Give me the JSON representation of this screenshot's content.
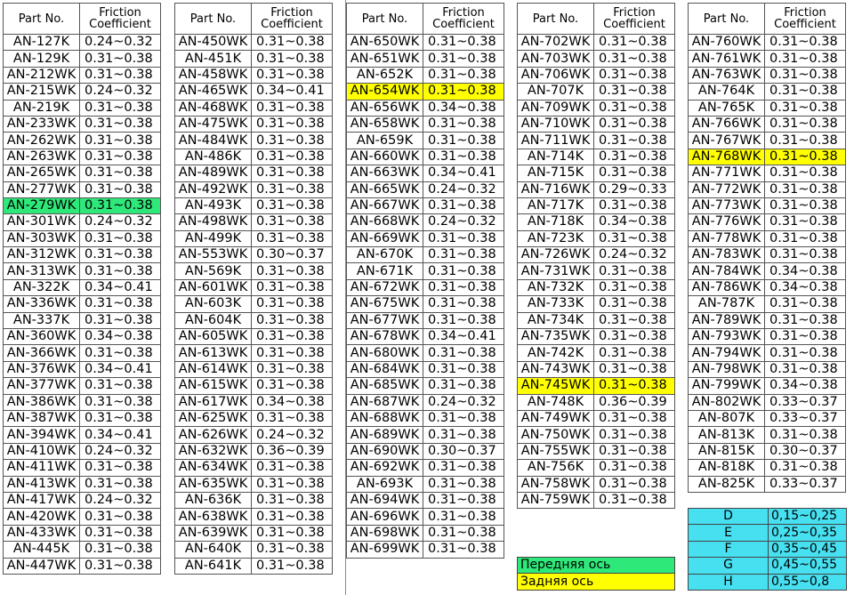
{
  "headers": {
    "part": "Part No.",
    "friction_line1": "Friction",
    "friction_line2": "Coefficient"
  },
  "highlight_colors": {
    "front_axle": "#2ee87a",
    "rear_axle": "#ffff00",
    "grade_table": "#47e0f0"
  },
  "columns": [
    {
      "rows": [
        {
          "part": "AN-127K",
          "coef": "0.24~0.32"
        },
        {
          "part": "AN-129K",
          "coef": "0.31~0.38"
        },
        {
          "part": "AN-212WK",
          "coef": "0.31~0.38"
        },
        {
          "part": "AN-215WK",
          "coef": "0.24~0.32"
        },
        {
          "part": "AN-219K",
          "coef": "0.31~0.38"
        },
        {
          "part": "AN-233WK",
          "coef": "0.31~0.38"
        },
        {
          "part": "AN-262WK",
          "coef": "0.31~0.38"
        },
        {
          "part": "AN-263WK",
          "coef": "0.31~0.38"
        },
        {
          "part": "AN-265WK",
          "coef": "0.31~0.38"
        },
        {
          "part": "AN-277WK",
          "coef": "0.31~0.38"
        },
        {
          "part": "AN-279WK",
          "coef": "0.31~0.38",
          "hl": "green"
        },
        {
          "part": "AN-301WK",
          "coef": "0.24~0.32"
        },
        {
          "part": "AN-303WK",
          "coef": "0.31~0.38"
        },
        {
          "part": "AN-312WK",
          "coef": "0.31~0.38"
        },
        {
          "part": "AN-313WK",
          "coef": "0.31~0.38"
        },
        {
          "part": "AN-322K",
          "coef": "0.34~0.41"
        },
        {
          "part": "AN-336WK",
          "coef": "0.31~0.38"
        },
        {
          "part": "AN-337K",
          "coef": "0.31~0.38"
        },
        {
          "part": "AN-360WK",
          "coef": "0.34~0.38"
        },
        {
          "part": "AN-366WK",
          "coef": "0.31~0.38"
        },
        {
          "part": "AN-376WK",
          "coef": "0.34~0.41"
        },
        {
          "part": "AN-377WK",
          "coef": "0.31~0.38"
        },
        {
          "part": "AN-386WK",
          "coef": "0.31~0.38"
        },
        {
          "part": "AN-387WK",
          "coef": "0.31~0.38"
        },
        {
          "part": "AN-394WK",
          "coef": "0.34~0.41"
        },
        {
          "part": "AN-410WK",
          "coef": "0.24~0.32"
        },
        {
          "part": "AN-411WK",
          "coef": "0.31~0.38"
        },
        {
          "part": "AN-413WK",
          "coef": "0.31~0.38"
        },
        {
          "part": "AN-417WK",
          "coef": "0.24~0.32"
        },
        {
          "part": "AN-420WK",
          "coef": "0.31~0.38"
        },
        {
          "part": "AN-433WK",
          "coef": "0.31~0.38"
        },
        {
          "part": "AN-445K",
          "coef": "0.31~0.38"
        },
        {
          "part": "AN-447WK",
          "coef": "0.31~0.38"
        }
      ]
    },
    {
      "rows": [
        {
          "part": "AN-450WK",
          "coef": "0.31~0.38"
        },
        {
          "part": "AN-451K",
          "coef": "0.31~0.38"
        },
        {
          "part": "AN-458WK",
          "coef": "0.31~0.38"
        },
        {
          "part": "AN-465WK",
          "coef": "0.34~0.41"
        },
        {
          "part": "AN-468WK",
          "coef": "0.31~0.38"
        },
        {
          "part": "AN-475WK",
          "coef": "0.31~0.38"
        },
        {
          "part": "AN-484WK",
          "coef": "0.31~0.38"
        },
        {
          "part": "AN-486K",
          "coef": "0.31~0.38"
        },
        {
          "part": "AN-489WK",
          "coef": "0.31~0.38"
        },
        {
          "part": "AN-492WK",
          "coef": "0.31~0.38"
        },
        {
          "part": "AN-493K",
          "coef": "0.31~0.38"
        },
        {
          "part": "AN-498WK",
          "coef": "0.31~0.38"
        },
        {
          "part": "AN-499K",
          "coef": "0.31~0.38"
        },
        {
          "part": "AN-553WK",
          "coef": "0.30~0.37"
        },
        {
          "part": "AN-569K",
          "coef": "0.31~0.38"
        },
        {
          "part": "AN-601WK",
          "coef": "0.31~0.38"
        },
        {
          "part": "AN-603K",
          "coef": "0.31~0.38"
        },
        {
          "part": "AN-604K",
          "coef": "0.31~0.38"
        },
        {
          "part": "AN-605WK",
          "coef": "0.31~0.38"
        },
        {
          "part": "AN-613WK",
          "coef": "0.31~0.38"
        },
        {
          "part": "AN-614WK",
          "coef": "0.31~0.38"
        },
        {
          "part": "AN-615WK",
          "coef": "0.31~0.38"
        },
        {
          "part": "AN-617WK",
          "coef": "0.34~0.38"
        },
        {
          "part": "AN-625WK",
          "coef": "0.31~0.38"
        },
        {
          "part": "AN-626WK",
          "coef": "0.24~0.32"
        },
        {
          "part": "AN-632WK",
          "coef": "0.36~0.39"
        },
        {
          "part": "AN-634WK",
          "coef": "0.31~0.38"
        },
        {
          "part": "AN-635WK",
          "coef": "0.31~0.38"
        },
        {
          "part": "AN-636K",
          "coef": "0.31~0.38"
        },
        {
          "part": "AN-638WK",
          "coef": "0.31~0.38"
        },
        {
          "part": "AN-639WK",
          "coef": "0.31~0.38"
        },
        {
          "part": "AN-640K",
          "coef": "0.31~0.38"
        },
        {
          "part": "AN-641K",
          "coef": "0.31~0.38"
        }
      ]
    },
    {
      "rows": [
        {
          "part": "AN-650WK",
          "coef": "0.31~0.38"
        },
        {
          "part": "AN-651WK",
          "coef": "0.31~0.38"
        },
        {
          "part": "AN-652K",
          "coef": "0.31~0.38"
        },
        {
          "part": "AN-654WK",
          "coef": "0.31~0.38",
          "hl": "yellow"
        },
        {
          "part": "AN-656WK",
          "coef": "0.34~0.38"
        },
        {
          "part": "AN-658WK",
          "coef": "0.31~0.38"
        },
        {
          "part": "AN-659K",
          "coef": "0.31~0.38"
        },
        {
          "part": "AN-660WK",
          "coef": "0.31~0.38"
        },
        {
          "part": "AN-663WK",
          "coef": "0.34~0.41"
        },
        {
          "part": "AN-665WK",
          "coef": "0.24~0.32"
        },
        {
          "part": "AN-667WK",
          "coef": "0.31~0.38"
        },
        {
          "part": "AN-668WK",
          "coef": "0.24~0.32"
        },
        {
          "part": "AN-669WK",
          "coef": "0.31~0.38"
        },
        {
          "part": "AN-670K",
          "coef": "0.31~0.38"
        },
        {
          "part": "AN-671K",
          "coef": "0.31~0.38"
        },
        {
          "part": "AN-672WK",
          "coef": "0.31~0.38"
        },
        {
          "part": "AN-675WK",
          "coef": "0.31~0.38"
        },
        {
          "part": "AN-677WK",
          "coef": "0.31~0.38"
        },
        {
          "part": "AN-678WK",
          "coef": "0.34~0.41"
        },
        {
          "part": "AN-680WK",
          "coef": "0.31~0.38"
        },
        {
          "part": "AN-684WK",
          "coef": "0.31~0.38"
        },
        {
          "part": "AN-685WK",
          "coef": "0.31~0.38"
        },
        {
          "part": "AN-687WK",
          "coef": "0.24~0.32"
        },
        {
          "part": "AN-688WK",
          "coef": "0.31~0.38"
        },
        {
          "part": "AN-689WK",
          "coef": "0.31~0.38"
        },
        {
          "part": "AN-690WK",
          "coef": "0.30~0.37"
        },
        {
          "part": "AN-692WK",
          "coef": "0.31~0.38"
        },
        {
          "part": "AN-693K",
          "coef": "0.31~0.38"
        },
        {
          "part": "AN-694WK",
          "coef": "0.31~0.38"
        },
        {
          "part": "AN-696WK",
          "coef": "0.31~0.38"
        },
        {
          "part": "AN-698WK",
          "coef": "0.31~0.38"
        },
        {
          "part": "AN-699WK",
          "coef": "0.31~0.38"
        }
      ]
    },
    {
      "rows": [
        {
          "part": "AN-702WK",
          "coef": "0.31~0.38"
        },
        {
          "part": "AN-703WK",
          "coef": "0.31~0.38"
        },
        {
          "part": "AN-706WK",
          "coef": "0.31~0.38"
        },
        {
          "part": "AN-707K",
          "coef": "0.31~0.38"
        },
        {
          "part": "AN-709WK",
          "coef": "0.31~0.38"
        },
        {
          "part": "AN-710WK",
          "coef": "0.31~0.38"
        },
        {
          "part": "AN-711WK",
          "coef": "0.31~0.38"
        },
        {
          "part": "AN-714K",
          "coef": "0.31~0.38"
        },
        {
          "part": "AN-715K",
          "coef": "0.31~0.38"
        },
        {
          "part": "AN-716WK",
          "coef": "0.29~0.33"
        },
        {
          "part": "AN-717K",
          "coef": "0.31~0.38"
        },
        {
          "part": "AN-718K",
          "coef": "0.34~0.38"
        },
        {
          "part": "AN-723K",
          "coef": "0.31~0.38"
        },
        {
          "part": "AN-726WK",
          "coef": "0.24~0.32"
        },
        {
          "part": "AN-731WK",
          "coef": "0.31~0.38"
        },
        {
          "part": "AN-732K",
          "coef": "0.31~0.38"
        },
        {
          "part": "AN-733K",
          "coef": "0.31~0.38"
        },
        {
          "part": "AN-734K",
          "coef": "0.31~0.38"
        },
        {
          "part": "AN-735WK",
          "coef": "0.31~0.38"
        },
        {
          "part": "AN-742K",
          "coef": "0.31~0.38"
        },
        {
          "part": "AN-743WK",
          "coef": "0.31~0.38"
        },
        {
          "part": "AN-745WK",
          "coef": "0.31~0.38",
          "hl": "yellow"
        },
        {
          "part": "AN-748K",
          "coef": "0.36~0.39"
        },
        {
          "part": "AN-749WK",
          "coef": "0.31~0.38"
        },
        {
          "part": "AN-750WK",
          "coef": "0.31~0.38"
        },
        {
          "part": "AN-755WK",
          "coef": "0.31~0.38"
        },
        {
          "part": "AN-756K",
          "coef": "0.31~0.38"
        },
        {
          "part": "AN-758WK",
          "coef": "0.31~0.38"
        },
        {
          "part": "AN-759WK",
          "coef": "0.31~0.38"
        }
      ]
    },
    {
      "rows": [
        {
          "part": "AN-760WK",
          "coef": "0.31~0.38"
        },
        {
          "part": "AN-761WK",
          "coef": "0.31~0.38"
        },
        {
          "part": "AN-763WK",
          "coef": "0.31~0.38"
        },
        {
          "part": "AN-764K",
          "coef": "0.31~0.38"
        },
        {
          "part": "AN-765K",
          "coef": "0.31~0.38"
        },
        {
          "part": "AN-766WK",
          "coef": "0.31~0.38"
        },
        {
          "part": "AN-767WK",
          "coef": "0.31~0.38"
        },
        {
          "part": "AN-768WK",
          "coef": "0.31~0.38",
          "hl": "yellow"
        },
        {
          "part": "AN-771WK",
          "coef": "0.31~0.38"
        },
        {
          "part": "AN-772WK",
          "coef": "0.31~0.38"
        },
        {
          "part": "AN-773WK",
          "coef": "0.31~0.38"
        },
        {
          "part": "AN-776WK",
          "coef": "0.31~0.38"
        },
        {
          "part": "AN-778WK",
          "coef": "0.31~0.38"
        },
        {
          "part": "AN-783WK",
          "coef": "0.31~0.38"
        },
        {
          "part": "AN-784WK",
          "coef": "0.34~0.38"
        },
        {
          "part": "AN-786WK",
          "coef": "0.34~0.38"
        },
        {
          "part": "AN-787K",
          "coef": "0.31~0.38"
        },
        {
          "part": "AN-789WK",
          "coef": "0.31~0.38"
        },
        {
          "part": "AN-793WK",
          "coef": "0.31~0.38"
        },
        {
          "part": "AN-794WK",
          "coef": "0.31~0.38"
        },
        {
          "part": "AN-798WK",
          "coef": "0.31~0.38"
        },
        {
          "part": "AN-799WK",
          "coef": "0.34~0.38"
        },
        {
          "part": "AN-802WK",
          "coef": "0.33~0.37"
        },
        {
          "part": "AN-807K",
          "coef": "0.33~0.37"
        },
        {
          "part": "AN-813K",
          "coef": "0.31~0.38"
        },
        {
          "part": "AN-815K",
          "coef": "0.30~0.37"
        },
        {
          "part": "AN-818K",
          "coef": "0.31~0.38"
        },
        {
          "part": "AN-825K",
          "coef": "0.33~0.37"
        }
      ]
    }
  ],
  "axle_legend": {
    "front": "Передняя ось",
    "rear": "Задняя ось"
  },
  "grade_legend": [
    {
      "grade": "D",
      "range": "0,15~0,25"
    },
    {
      "grade": "E",
      "range": "0,25~0,35"
    },
    {
      "grade": "F",
      "range": "0,35~0,45"
    },
    {
      "grade": "G",
      "range": "0,45~0,55"
    },
    {
      "grade": "H",
      "range": "0,55~0,8"
    }
  ]
}
